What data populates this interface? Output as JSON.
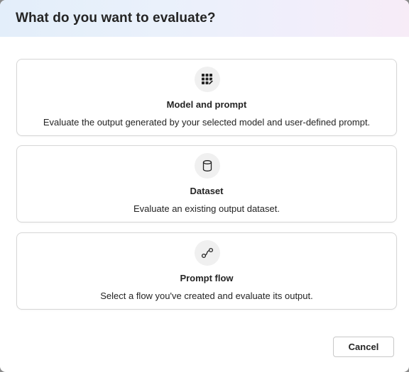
{
  "dialog": {
    "title": "What do you want to evaluate?"
  },
  "options": [
    {
      "icon": "table-edit-icon",
      "title": "Model and prompt",
      "description": "Evaluate the output generated by your selected model and user-defined prompt."
    },
    {
      "icon": "database-icon",
      "title": "Dataset",
      "description": "Evaluate an existing output dataset."
    },
    {
      "icon": "flow-icon",
      "title": "Prompt flow",
      "description": "Select a flow you've created and evaluate its output."
    }
  ],
  "footer": {
    "cancel_label": "Cancel"
  }
}
